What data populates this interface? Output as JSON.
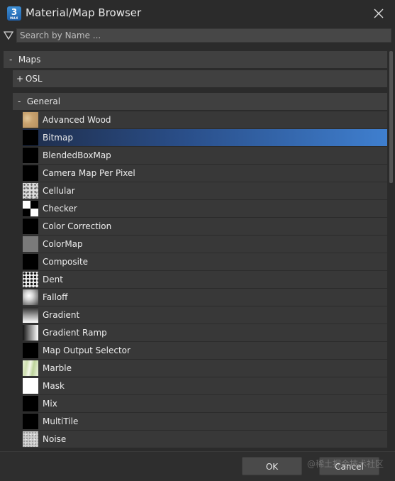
{
  "window": {
    "title": "Material/Map Browser",
    "app_icon_text": "3",
    "app_icon_sub": "MAX"
  },
  "search": {
    "placeholder": "Search by Name ...",
    "value": ""
  },
  "tree": {
    "root": {
      "toggle": "-",
      "label": "Maps"
    },
    "groups": [
      {
        "toggle": "+",
        "label": "OSL"
      },
      {
        "toggle": "-",
        "label": "General"
      }
    ],
    "items": [
      {
        "label": "Advanced Wood",
        "icon": "wood-swatch-icon",
        "selected": false
      },
      {
        "label": "Bitmap",
        "icon": "black-swatch-icon",
        "selected": true
      },
      {
        "label": "BlendedBoxMap",
        "icon": "black-swatch-icon",
        "selected": false
      },
      {
        "label": "Camera Map Per Pixel",
        "icon": "black-swatch-icon",
        "selected": false
      },
      {
        "label": "Cellular",
        "icon": "cellular-swatch-icon",
        "selected": false
      },
      {
        "label": "Checker",
        "icon": "checker-swatch-icon",
        "selected": false
      },
      {
        "label": "Color Correction",
        "icon": "black-swatch-icon",
        "selected": false
      },
      {
        "label": "ColorMap",
        "icon": "gray-swatch-icon",
        "selected": false
      },
      {
        "label": "Composite",
        "icon": "black-swatch-icon",
        "selected": false
      },
      {
        "label": "Dent",
        "icon": "dent-swatch-icon",
        "selected": false
      },
      {
        "label": "Falloff",
        "icon": "falloff-swatch-icon",
        "selected": false
      },
      {
        "label": "Gradient",
        "icon": "gradient-swatch-icon",
        "selected": false
      },
      {
        "label": "Gradient Ramp",
        "icon": "gradient-ramp-swatch-icon",
        "selected": false
      },
      {
        "label": "Map Output Selector",
        "icon": "black-swatch-icon",
        "selected": false
      },
      {
        "label": "Marble",
        "icon": "marble-swatch-icon",
        "selected": false
      },
      {
        "label": "Mask",
        "icon": "white-swatch-icon",
        "selected": false
      },
      {
        "label": "Mix",
        "icon": "black-swatch-icon",
        "selected": false
      },
      {
        "label": "MultiTile",
        "icon": "black-swatch-icon",
        "selected": false
      },
      {
        "label": "Noise",
        "icon": "noise-swatch-icon",
        "selected": false
      }
    ]
  },
  "footer": {
    "ok_label": "OK",
    "cancel_label": "Cancel",
    "watermark": "@稀土掘金技术社区"
  },
  "colors": {
    "selection": "#3f7fcf",
    "background": "#2b2b2b",
    "row": "#383838",
    "group_header": "#404040"
  }
}
